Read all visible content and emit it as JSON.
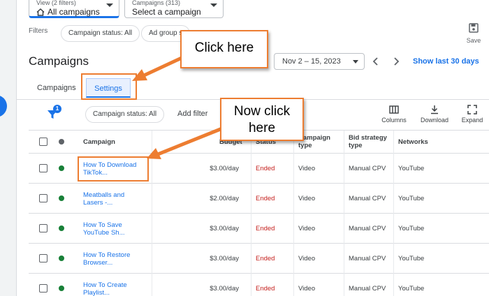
{
  "header": {
    "view_selector": {
      "caption": "View (2 filters)",
      "value": "All campaigns"
    },
    "campaign_selector": {
      "caption": "Campaigns (313)",
      "value": "Select a campaign"
    }
  },
  "filters": {
    "label": "Filters",
    "chips": [
      "Campaign status: All",
      "Ad group s"
    ],
    "save_label": "Save"
  },
  "page": {
    "title": "Campaigns",
    "date_range": "Nov 2 – 15, 2023",
    "show_last": "Show last 30 days"
  },
  "tabs": [
    {
      "label": "Campaigns",
      "active": false
    },
    {
      "label": "Settings",
      "active": true
    }
  ],
  "toolbar": {
    "filter_badge": "1",
    "status_chip": "Campaign status: All",
    "add_filter": "Add filter",
    "columns_label": "Columns",
    "download_label": "Download",
    "expand_label": "Expand"
  },
  "table": {
    "headers": {
      "campaign": "Campaign",
      "budget": "Budget",
      "status": "Status",
      "type_line1": "Campaign",
      "type_line2": "type",
      "bid_line1": "Bid strategy",
      "bid_line2": "type",
      "networks": "Networks"
    },
    "rows": [
      {
        "name_line1": "How To Download",
        "name_line2": "TikTok...",
        "budget": "$3.00/day",
        "status": "Ended",
        "type": "Video",
        "bid": "Manual CPV",
        "network": "YouTube"
      },
      {
        "name_line1": "Meatballs and",
        "name_line2": "Lasers -...",
        "budget": "$2.00/day",
        "status": "Ended",
        "type": "Video",
        "bid": "Manual CPV",
        "network": "YouTube"
      },
      {
        "name_line1": "How To Save",
        "name_line2": "YouTube Sh...",
        "budget": "$3.00/day",
        "status": "Ended",
        "type": "Video",
        "bid": "Manual CPV",
        "network": "YouTube"
      },
      {
        "name_line1": "How To Restore",
        "name_line2": "Browser...",
        "budget": "$3.00/day",
        "status": "Ended",
        "type": "Video",
        "bid": "Manual CPV",
        "network": "YouTube"
      },
      {
        "name_line1": "How To Create",
        "name_line2": "Playlist...",
        "budget": "$3.00/day",
        "status": "Ended",
        "type": "Video",
        "bid": "Manual CPV",
        "network": "YouTube"
      }
    ]
  },
  "annotations": {
    "callout_1": "Click here",
    "callout_2_line1": "Now click",
    "callout_2_line2": "here",
    "color": "#ed7d31"
  },
  "colors": {
    "accent": "#1a73e8",
    "status_ended": "#c5221f",
    "enabled_dot": "#188038"
  }
}
